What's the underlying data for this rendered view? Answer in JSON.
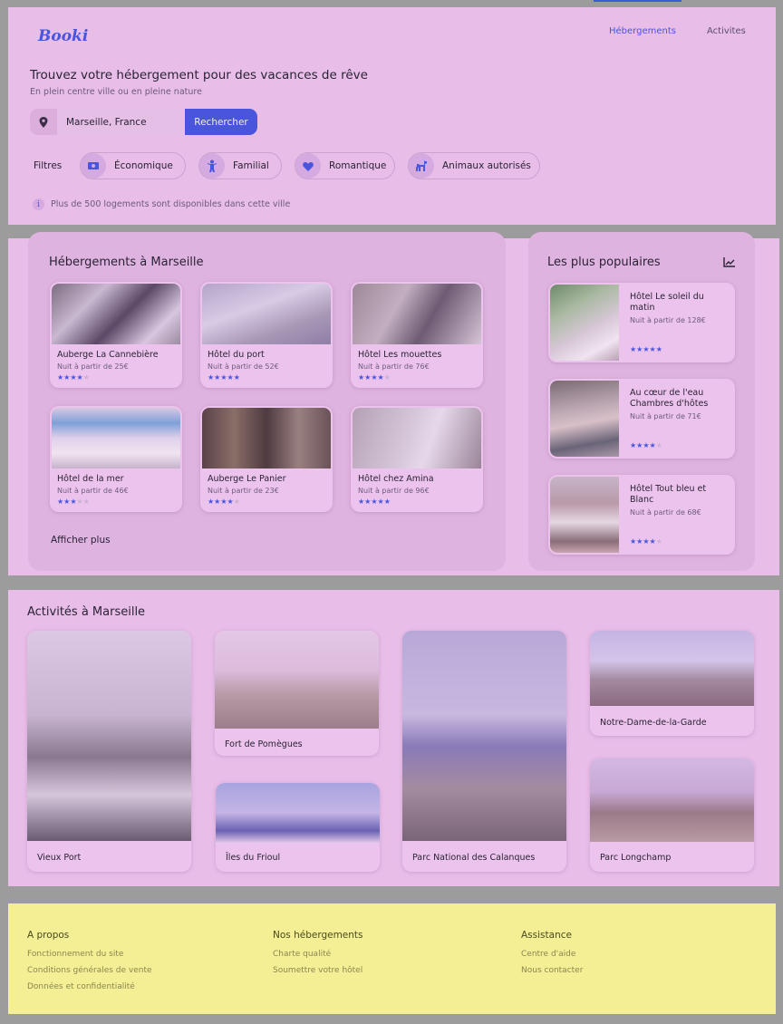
{
  "header": {
    "logo": "Booki",
    "nav": [
      "Hébergements",
      "Activites"
    ],
    "title": "Trouvez votre hébergement pour des vacances de rêve",
    "subtitle": "En plein centre ville ou en pleine nature",
    "search": {
      "value": "Marseille, France",
      "button": "Rechercher"
    },
    "filters_label": "Filtres",
    "filters": [
      {
        "label": "Économique",
        "icon": "money-icon"
      },
      {
        "label": "Familial",
        "icon": "child-icon"
      },
      {
        "label": "Romantique",
        "icon": "heart-icon"
      },
      {
        "label": "Animaux autorisés",
        "icon": "dog-icon"
      }
    ],
    "info": "Plus de 500 logements sont disponibles dans cette ville"
  },
  "hotels": {
    "title": "Hébergements à Marseille",
    "items": [
      {
        "name": "Auberge La Cannebière",
        "price": "Nuit à partir de 25€",
        "rating": 4
      },
      {
        "name": "Hôtel du port",
        "price": "Nuit à partir de 52€",
        "rating": 5
      },
      {
        "name": "Hôtel Les mouettes",
        "price": "Nuit à partir de 76€",
        "rating": 4
      },
      {
        "name": "Hôtel de la mer",
        "price": "Nuit à partir de 46€",
        "rating": 3
      },
      {
        "name": "Auberge Le Panier",
        "price": "Nuit à partir de 23€",
        "rating": 4
      },
      {
        "name": "Hôtel chez Amina",
        "price": "Nuit à partir de 96€",
        "rating": 5
      }
    ],
    "show_more": "Afficher plus"
  },
  "popular": {
    "title": "Les plus populaires",
    "items": [
      {
        "name": "Hôtel Le soleil du matin",
        "price": "Nuit à partir de 128€",
        "rating": 5
      },
      {
        "name": "Au cœur de l'eau Chambres d'hôtes",
        "price": "Nuit à partir de 71€",
        "rating": 4
      },
      {
        "name": "Hôtel Tout bleu et Blanc",
        "price": "Nuit à partir de 68€",
        "rating": 4
      }
    ]
  },
  "activities": {
    "title": "Activités à Marseille",
    "items": [
      "Vieux Port",
      "Fort de Pomègues",
      "Îles du Frioul",
      "Parc National des Calanques",
      "Notre-Dame-de-la-Garde",
      "Parc Longchamp"
    ]
  },
  "footer": {
    "columns": [
      {
        "title": "A propos",
        "links": [
          "Fonctionnement du site",
          "Conditions générales de vente",
          "Données et confidentialité"
        ]
      },
      {
        "title": "Nos hébergements",
        "links": [
          "Charte qualité",
          "Soumettre votre hôtel"
        ]
      },
      {
        "title": "Assistance",
        "links": [
          "Centre d'aide",
          "Nous contacter"
        ]
      }
    ]
  },
  "colors": {
    "accent": "#4a55dd",
    "section_bg": "#e8bde8",
    "footer_bg": "#f4ef94"
  }
}
